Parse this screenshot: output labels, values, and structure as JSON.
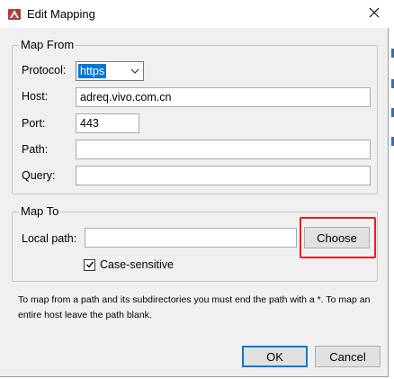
{
  "window": {
    "title": "Edit Mapping",
    "app_icon": "charles-app-icon",
    "close_icon": "close-icon"
  },
  "map_from": {
    "legend": "Map From",
    "protocol_label": "Protocol:",
    "protocol_value": "https",
    "host_label": "Host:",
    "host_value": "adreq.vivo.com.cn",
    "port_label": "Port:",
    "port_value": "443",
    "path_label": "Path:",
    "path_value": "",
    "query_label": "Query:",
    "query_value": ""
  },
  "map_to": {
    "legend": "Map To",
    "local_path_label": "Local path:",
    "local_path_value": "",
    "choose_label": "Choose",
    "case_sensitive_label": "Case-sensitive",
    "case_sensitive_checked": true
  },
  "hint": {
    "text": "To map from a path and its subdirectories you must end the path with a *. To map an entire host leave the path blank."
  },
  "buttons": {
    "ok_label": "OK",
    "cancel_label": "Cancel"
  },
  "colors": {
    "selection": "#0078d7",
    "annotation_highlight": "#e8201a"
  }
}
